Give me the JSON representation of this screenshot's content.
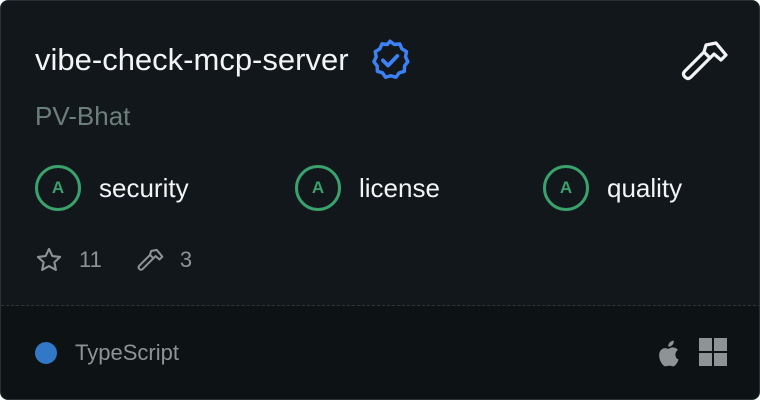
{
  "card": {
    "title": "vibe-check-mcp-server",
    "author": "PV-Bhat",
    "verified_icon": "verified-badge-icon",
    "tool_icon": "hammer-icon",
    "grades": [
      {
        "grade": "A",
        "label": "security"
      },
      {
        "grade": "A",
        "label": "license"
      },
      {
        "grade": "A",
        "label": "quality"
      }
    ],
    "stats": {
      "stars": "11",
      "tools": "3"
    },
    "language": {
      "name": "TypeScript",
      "color": "#3178c6"
    },
    "platforms": [
      "apple-icon",
      "windows-icon"
    ]
  },
  "colors": {
    "background": "#11171a",
    "footer": "#0d1214",
    "grade_accent": "#3aa06c",
    "verified_accent": "#3b82f6",
    "muted_text": "#8e9396",
    "author_text": "#6d7f7a"
  }
}
